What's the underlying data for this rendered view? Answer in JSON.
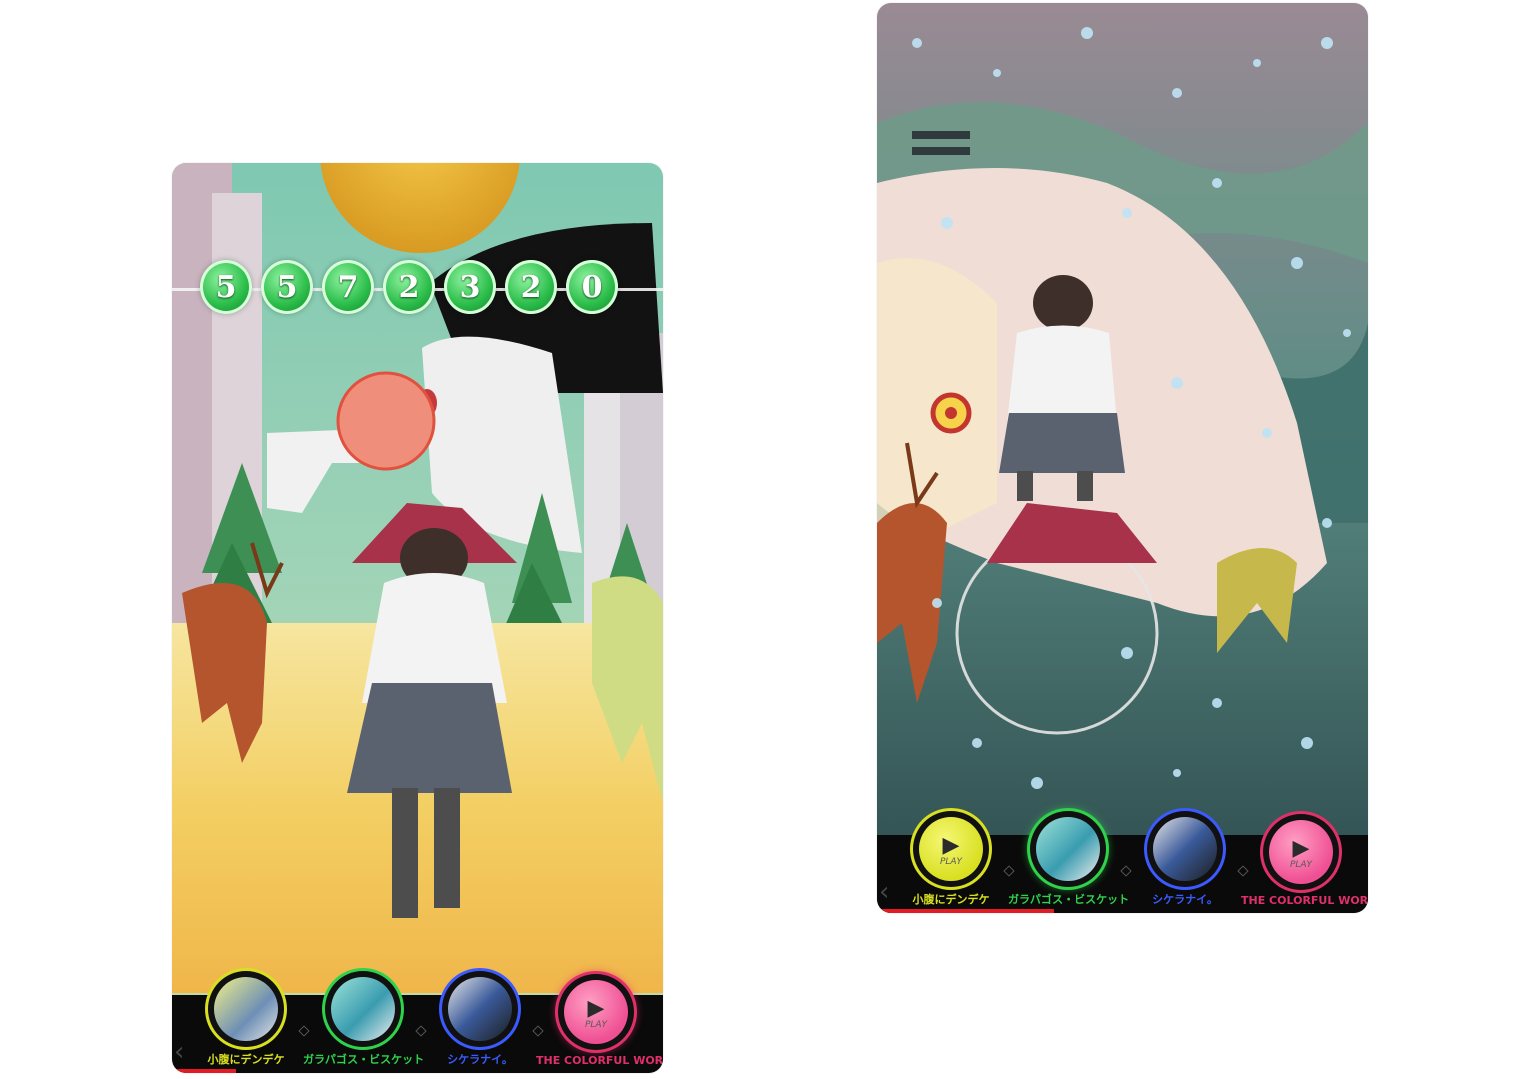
{
  "screens": [
    {
      "score_digits": [
        "5",
        "5",
        "7",
        "2",
        "3",
        "2",
        "0"
      ],
      "progress": 0.13,
      "selected_track": 3,
      "tracks": [
        {
          "label": "小腹にデンデケ",
          "color": "#d9e021",
          "mode": "thumbnail"
        },
        {
          "label": "ガラパゴス・ビスケット",
          "color": "#2fd24b",
          "mode": "thumbnail"
        },
        {
          "label": "シケラナイ。",
          "color": "#3b5bff",
          "mode": "thumbnail"
        },
        {
          "label": "THE COLORFUL WORLD",
          "color": "#e0306a",
          "mode": "play",
          "play_label": "PLAY"
        }
      ]
    },
    {
      "progress": 0.36,
      "selected_track": 1,
      "tracks": [
        {
          "label": "小腹にデンデケ",
          "color": "#d9e021",
          "mode": "play",
          "play_label": "PLAY"
        },
        {
          "label": "ガラパゴス・ビスケット",
          "color": "#2fd24b",
          "mode": "thumbnail"
        },
        {
          "label": "シケラナイ。",
          "color": "#3b5bff",
          "mode": "thumbnail"
        },
        {
          "label": "THE COLORFUL WORLD",
          "color": "#e0306a",
          "mode": "play",
          "play_label": "PLAY"
        }
      ]
    }
  ],
  "colors": {
    "track_bar": "#0a0a0a",
    "progress": "#e31b23",
    "score_digit": "#2bbd4a"
  }
}
